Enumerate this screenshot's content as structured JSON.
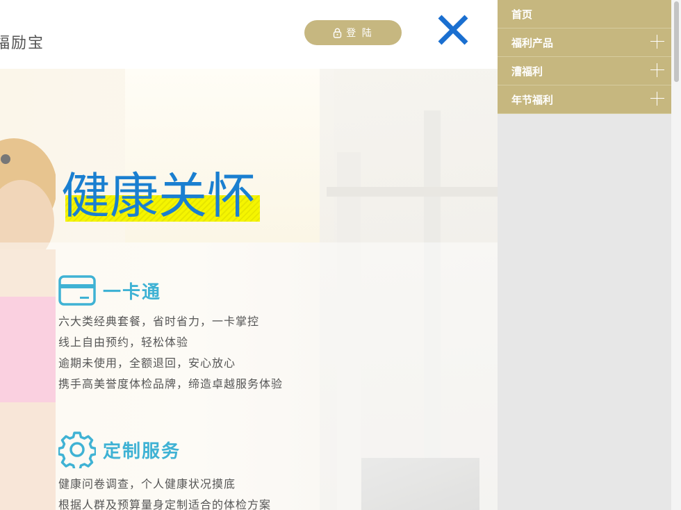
{
  "header": {
    "brand": "福励宝",
    "login_label": "登 陆"
  },
  "hero": {
    "title": "健康关怀"
  },
  "features": [
    {
      "title": "一卡通",
      "icon": "card-icon",
      "lines": [
        "六大类经典套餐，省时省力，一卡掌控",
        "线上自由预约，轻松体验",
        "逾期未使用，全额退回，安心放心",
        "携手高美誉度体检品牌，缔造卓越服务体验"
      ]
    },
    {
      "title": "定制服务",
      "icon": "gear-icon",
      "lines": [
        "健康问卷调查，个人健康状况摸底",
        "根据人群及预算量身定制适合的体检方案"
      ]
    }
  ],
  "sidebar": {
    "items": [
      {
        "label": "首页",
        "expandable": false
      },
      {
        "label": "福利产品",
        "expandable": true
      },
      {
        "label": "漕福利",
        "expandable": true
      },
      {
        "label": "年节福利",
        "expandable": true
      }
    ]
  },
  "colors": {
    "accent_gold": "#c6b780",
    "close_blue": "#1a6fd0",
    "title_blue": "#1a7fd0",
    "feature_cyan": "#3fb2d4",
    "highlight_yellow": "#f5f500"
  }
}
